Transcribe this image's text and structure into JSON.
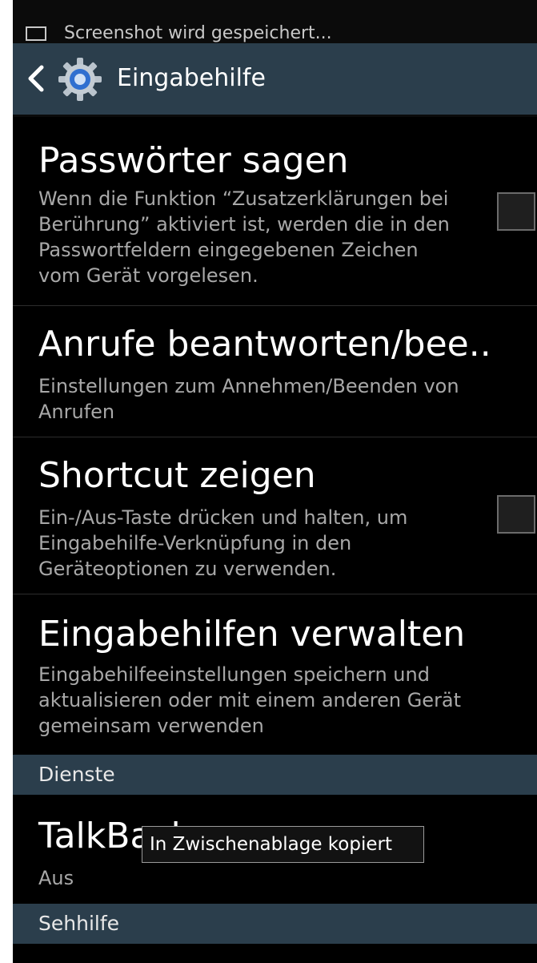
{
  "notification": {
    "text": "Screenshot wird gespeichert..."
  },
  "actionbar": {
    "title": "Eingabehilfe",
    "back_icon": "chevron-left-icon",
    "app_icon": "gear-icon"
  },
  "items": [
    {
      "title": "Passwörter sagen",
      "summary": "Wenn die Funktion “Zusatzerklärungen bei\nBerührung” aktiviert ist, werden die in den\nPasswortfeldern eingegebenen Zeichen\nvom Gerät vorgelesen.",
      "checked": false
    },
    {
      "title": "Anrufe beantworten/bee..",
      "summary": "Einstellungen zum Annehmen/Beenden von\nAnrufen"
    },
    {
      "title": "Shortcut zeigen",
      "summary": "Ein-/Aus-Taste drücken und halten, um\nEingabehilfe-Verknüpfung in den\nGeräteoptionen zu verwenden.",
      "checked": false
    },
    {
      "title": "Eingabehilfen verwalten",
      "summary": "Eingabehilfeeinstellungen speichern und\naktualisieren oder mit einem anderen Gerät\ngemeinsam verwenden"
    }
  ],
  "sections": {
    "services": "Dienste",
    "vision": "Sehhilfe"
  },
  "talkback": {
    "title": "TalkBack",
    "summary": "Aus"
  },
  "toast": {
    "text": "In Zwischenablage kopiert"
  },
  "colors": {
    "actionbar": "#2b3e4c",
    "background": "#000000",
    "summary_text": "#a8a8a8"
  }
}
